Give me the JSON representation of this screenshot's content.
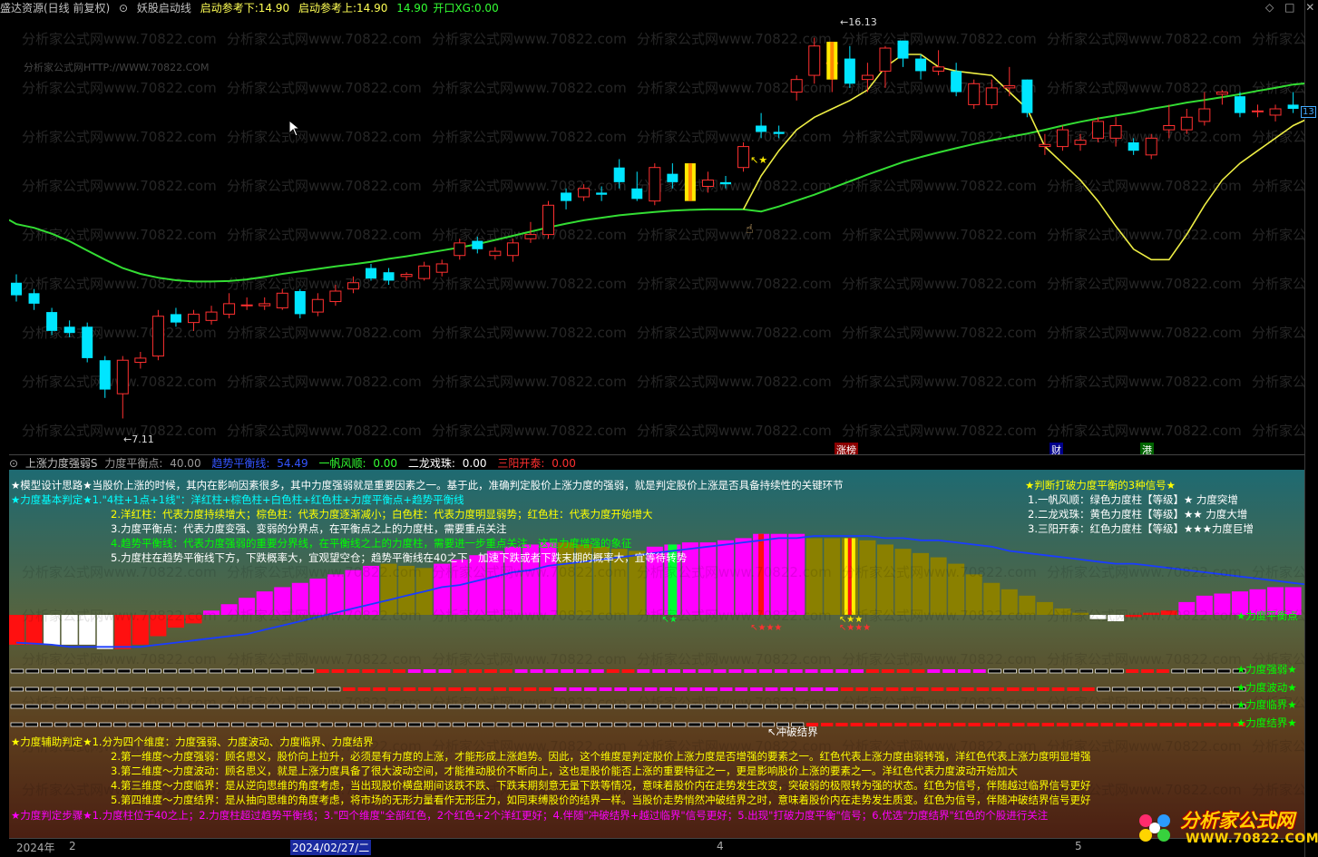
{
  "title_bar": {
    "app": "盛达资源(日线 前复权)",
    "indicator": "妖股启动线",
    "lower_ref_label": "启动参考下:",
    "lower_ref_value": "14.90",
    "upper_ref_label": "启动参考上:",
    "upper_ref_value": "14.90",
    "open_label": "14.90",
    "xg_label": "开口XG:",
    "xg_value": "0.00"
  },
  "watermark": {
    "line": "分析家公式网www.70822.com",
    "url": "分析家公式网HTTP://WWW.70822.COM"
  },
  "price_labels": {
    "high": "16.13",
    "low": "7.11",
    "right_tag": "13"
  },
  "main_marks": {
    "zhangbang": "涨榜",
    "cai": "财",
    "gang": "港"
  },
  "indicator_bar": {
    "name": "上涨力度强弱S",
    "balance_label": "力度平衡点:",
    "balance_value": "40.00",
    "trend_label": "趋势平衡线:",
    "trend_value": "54.49",
    "yifan_label": "一帆风顺:",
    "yifan_value": "0.00",
    "erlong_label": "二龙戏珠:",
    "erlong_value": "0.00",
    "sanyang_label": "三阳开泰:",
    "sanyang_value": "0.00"
  },
  "notes_top": [
    "★模型设计思路★当股价上涨的时候，其内在影响因素很多，其中力度强弱就是重要因素之一。基于此，准确判定股价上涨力度的强弱，就是判定股价上涨是否具备持续性的关键环节",
    "★力度基本判定★1.\"4柱+1点+1线\"：洋红柱+棕色柱+白色柱+红色柱+力度平衡点+趋势平衡线",
    "2.洋红柱：代表力度持续增大；棕色柱：代表力度逐渐减小；白色柱：代表力度明显弱势；红色柱：代表力度开始增大",
    "3.力度平衡点：代表力度变强、变弱的分界点，在平衡点之上的力度柱，需要重点关注",
    "4.趋势平衡线：代表力度强弱的重要分界线，在平衡线之上的力度柱，需要进一步重点关注，这是力度增强的象征",
    "5.力度柱在趋势平衡线下方，下跌概率大，宜观望空仓；趋势平衡线在40之下，加速下跌或者下跌末期的概率大，宜等待转势"
  ],
  "signals": {
    "title": "★判断打破力度平衡的3种信号★",
    "items": [
      "1.一帆风顺：绿色力度柱【等级】★    力度突增",
      "2.二龙戏珠：黄色力度柱【等级】★★  力度大增",
      "3.三阳开泰：红色力度柱【等级】★★★力度巨增"
    ]
  },
  "right_labels": {
    "balance": "★力度平衡点",
    "strength": "★力度强弱★",
    "wave": "★力度波动★",
    "critical": "★力度临界★",
    "boundary": "★力度结界★"
  },
  "chong_label": "冲破结界",
  "notes_bottom": [
    "★力度辅助判定★1.分为四个维度：力度强弱、力度波动、力度临界、力度结界",
    "2.第一维度～力度强弱：顾名思义，股价向上拉升，必须是有力度的上涨，才能形成上涨趋势。因此，这个维度是判定股价上涨力度是否增强的要素之一。红色代表上涨力度由弱转强，洋红色代表上涨力度明显增强",
    "3.第二维度～力度波动：顾名思义，就是上涨力度具备了很大波动空间，才能推动股价不断向上，这也是股价能否上涨的重要特征之一，更是影响股价上涨的要素之一。洋红色代表力度波动开始加大",
    "4.第三维度～力度临界：是从逆向思维的角度考虑，当出现股价横盘期间该跌不跌、下跌末期刻意无量下跌等情况，意味着股价内在走势发生改变，突破弱的极限转为强的状态。红色为信号，伴随越过临界信号更好",
    "5.第四维度～力度结界：是从抽向思维的角度考虑，将市场的无形力量看作无形压力，如同束缚股价的结界一样。当股价走势悄然冲破结界之时，意味着股价内在走势发生质变。红色为信号，伴随冲破结界信号更好",
    "★力度判定步骤★1.力度柱位于40之上；2.力度柱超过趋势平衡线；3.\"四个维度\"全部红色，2个红色+2个洋红更好；4.伴随\"冲破结界+越过临界\"信号更好；5.出现\"打破力度平衡\"信号；6.优选\"力度结界\"红色的个股进行关注"
  ],
  "date_bar": {
    "year": "2024年",
    "m2": "2",
    "cursor_date": "2024/02/27/二",
    "m4": "4",
    "m5": "5"
  },
  "logo": {
    "text": "分析家公式网",
    "url": "WWW.70822.COM"
  },
  "colors": {
    "up": "#ff3030",
    "down": "#00e5ff",
    "ma": "#33dd33",
    "yline": "#eeee44",
    "magenta": "#ff00ff",
    "olive": "#8a8000",
    "blue_line": "#1a3cff"
  },
  "candles": [
    {
      "o": 10.35,
      "c": 10.05,
      "h": 10.55,
      "l": 9.9
    },
    {
      "o": 10.1,
      "c": 9.85,
      "h": 10.2,
      "l": 9.7
    },
    {
      "o": 9.65,
      "c": 9.2,
      "h": 9.75,
      "l": 9.1
    },
    {
      "o": 9.3,
      "c": 9.15,
      "h": 9.45,
      "l": 9.05
    },
    {
      "o": 9.3,
      "c": 8.55,
      "h": 9.4,
      "l": 8.45
    },
    {
      "o": 8.5,
      "c": 7.8,
      "h": 8.6,
      "l": 7.6
    },
    {
      "o": 7.7,
      "c": 8.5,
      "h": 8.6,
      "l": 7.11
    },
    {
      "o": 8.45,
      "c": 8.55,
      "h": 8.7,
      "l": 8.3
    },
    {
      "o": 8.6,
      "c": 9.55,
      "h": 9.7,
      "l": 8.5
    },
    {
      "o": 9.6,
      "c": 9.4,
      "h": 9.75,
      "l": 9.3
    },
    {
      "o": 9.4,
      "c": 9.6,
      "h": 9.7,
      "l": 9.2
    },
    {
      "o": 9.45,
      "c": 9.65,
      "h": 9.8,
      "l": 9.35
    },
    {
      "o": 9.6,
      "c": 9.85,
      "h": 10.1,
      "l": 9.5
    },
    {
      "o": 9.8,
      "c": 9.82,
      "h": 10.0,
      "l": 9.7
    },
    {
      "o": 9.8,
      "c": 9.85,
      "h": 10.0,
      "l": 9.7
    },
    {
      "o": 9.75,
      "c": 10.1,
      "h": 10.2,
      "l": 9.7
    },
    {
      "o": 10.15,
      "c": 9.6,
      "h": 10.2,
      "l": 9.5
    },
    {
      "o": 9.65,
      "c": 9.95,
      "h": 10.1,
      "l": 9.55
    },
    {
      "o": 9.9,
      "c": 10.15,
      "h": 10.3,
      "l": 9.8
    },
    {
      "o": 10.2,
      "c": 10.35,
      "h": 10.5,
      "l": 10.1
    },
    {
      "o": 10.7,
      "c": 10.45,
      "h": 10.8,
      "l": 10.4
    },
    {
      "o": 10.6,
      "c": 10.4,
      "h": 10.7,
      "l": 10.3
    },
    {
      "o": 10.5,
      "c": 10.55,
      "h": 10.6,
      "l": 10.4
    },
    {
      "o": 10.45,
      "c": 10.75,
      "h": 10.85,
      "l": 10.4
    },
    {
      "o": 10.6,
      "c": 10.8,
      "h": 10.9,
      "l": 10.5
    },
    {
      "o": 11.0,
      "c": 11.3,
      "h": 11.4,
      "l": 10.9
    },
    {
      "o": 11.35,
      "c": 11.15,
      "h": 11.45,
      "l": 11.05
    },
    {
      "o": 11.0,
      "c": 11.1,
      "h": 11.2,
      "l": 10.9
    },
    {
      "o": 11.0,
      "c": 11.3,
      "h": 11.4,
      "l": 10.85
    },
    {
      "o": 11.4,
      "c": 11.5,
      "h": 11.8,
      "l": 11.3
    },
    {
      "o": 11.5,
      "c": 12.2,
      "h": 12.3,
      "l": 11.4
    },
    {
      "o": 12.5,
      "c": 12.3,
      "h": 12.6,
      "l": 12.1
    },
    {
      "o": 12.4,
      "c": 12.6,
      "h": 12.7,
      "l": 12.3
    },
    {
      "o": 12.5,
      "c": 12.45,
      "h": 12.65,
      "l": 12.3
    },
    {
      "o": 13.1,
      "c": 12.75,
      "h": 13.3,
      "l": 12.6
    },
    {
      "o": 12.6,
      "c": 12.35,
      "h": 13.0,
      "l": 12.3
    },
    {
      "o": 12.3,
      "c": 13.1,
      "h": 13.2,
      "l": 12.2
    },
    {
      "o": 12.95,
      "c": 12.75,
      "h": 13.2,
      "l": 12.6
    },
    {
      "o": 12.75,
      "c": 12.65,
      "h": 12.9,
      "l": 12.55
    },
    {
      "o": 12.65,
      "c": 12.8,
      "h": 13.0,
      "l": 12.5
    },
    {
      "o": 12.75,
      "c": 12.7,
      "h": 12.9,
      "l": 12.6
    },
    {
      "o": 13.1,
      "c": 13.6,
      "h": 13.7,
      "l": 13.0
    },
    {
      "o": 14.1,
      "c": 13.95,
      "h": 14.4,
      "l": 13.8
    },
    {
      "o": 13.95,
      "c": 13.9,
      "h": 14.1,
      "l": 13.8
    },
    {
      "o": 14.9,
      "c": 15.2,
      "h": 15.3,
      "l": 14.7
    },
    {
      "o": 15.3,
      "c": 16.0,
      "h": 16.2,
      "l": 15.1
    },
    {
      "o": 15.6,
      "c": 15.6,
      "h": 16.1,
      "l": 14.9
    },
    {
      "o": 15.7,
      "c": 15.1,
      "h": 16.0,
      "l": 15.0
    },
    {
      "o": 15.2,
      "c": 15.3,
      "h": 15.6,
      "l": 14.9
    },
    {
      "o": 15.4,
      "c": 15.95,
      "h": 16.0,
      "l": 15.0
    },
    {
      "o": 16.13,
      "c": 15.7,
      "h": 16.13,
      "l": 15.5
    },
    {
      "o": 15.7,
      "c": 15.4,
      "h": 15.8,
      "l": 15.2
    },
    {
      "o": 15.4,
      "c": 15.5,
      "h": 15.9,
      "l": 15.3
    },
    {
      "o": 15.4,
      "c": 14.9,
      "h": 15.6,
      "l": 14.8
    },
    {
      "o": 14.6,
      "c": 15.1,
      "h": 15.2,
      "l": 14.5
    },
    {
      "o": 14.6,
      "c": 15.0,
      "h": 15.2,
      "l": 14.5
    },
    {
      "o": 15.0,
      "c": 15.05,
      "h": 15.5,
      "l": 14.8
    },
    {
      "o": 15.2,
      "c": 14.4,
      "h": 15.2,
      "l": 14.3
    },
    {
      "o": 13.6,
      "c": 13.65,
      "h": 13.9,
      "l": 13.4
    },
    {
      "o": 13.6,
      "c": 14.0,
      "h": 14.1,
      "l": 13.5
    },
    {
      "o": 13.65,
      "c": 13.75,
      "h": 13.9,
      "l": 13.5
    },
    {
      "o": 13.8,
      "c": 14.2,
      "h": 14.3,
      "l": 13.7
    },
    {
      "o": 13.8,
      "c": 14.1,
      "h": 14.3,
      "l": 13.6
    },
    {
      "o": 13.7,
      "c": 13.5,
      "h": 13.8,
      "l": 13.4
    },
    {
      "o": 13.4,
      "c": 13.8,
      "h": 13.9,
      "l": 13.3
    },
    {
      "o": 14.0,
      "c": 14.1,
      "h": 14.6,
      "l": 13.8
    },
    {
      "o": 14.0,
      "c": 14.3,
      "h": 14.5,
      "l": 13.9
    },
    {
      "o": 14.2,
      "c": 14.5,
      "h": 14.9,
      "l": 14.1
    },
    {
      "o": 14.85,
      "c": 14.9,
      "h": 14.95,
      "l": 14.6
    },
    {
      "o": 14.8,
      "c": 14.4,
      "h": 14.9,
      "l": 14.3
    },
    {
      "o": 14.45,
      "c": 14.45,
      "h": 14.6,
      "l": 14.3
    },
    {
      "o": 14.35,
      "c": 14.5,
      "h": 14.6,
      "l": 14.2
    },
    {
      "o": 14.6,
      "c": 14.5,
      "h": 14.9,
      "l": 14.4
    },
    {
      "o": 14.4,
      "c": 14.9,
      "h": 15.3,
      "l": 14.3
    },
    {
      "o": 14.5,
      "c": 14.8,
      "h": 15.0,
      "l": 14.4
    }
  ],
  "ma_values": [
    11.75,
    11.66,
    11.52,
    11.34,
    11.12,
    10.9,
    10.7,
    10.56,
    10.47,
    10.41,
    10.38,
    10.38,
    10.39,
    10.43,
    10.49,
    10.56,
    10.62,
    10.68,
    10.74,
    10.79,
    10.85,
    10.92,
    10.98,
    11.05,
    11.12,
    11.19,
    11.27,
    11.37,
    11.47,
    11.57,
    11.67,
    11.76,
    11.84,
    11.9,
    11.96,
    12.0,
    12.04,
    12.07,
    12.09,
    12.1,
    12.1,
    12.1,
    12.05,
    12.17,
    12.31,
    12.45,
    12.61,
    12.77,
    12.93,
    13.08,
    13.23,
    13.35,
    13.46,
    13.56,
    13.66,
    13.75,
    13.83,
    13.91,
    14.0,
    14.1,
    14.19,
    14.27,
    14.34,
    14.41,
    14.5,
    14.57,
    14.65,
    14.71,
    14.78,
    14.85,
    14.93,
    15.0,
    15.08,
    15.12,
    15.15
  ],
  "yline_values": [
    null,
    null,
    null,
    null,
    null,
    null,
    null,
    null,
    null,
    null,
    null,
    null,
    null,
    null,
    null,
    null,
    null,
    null,
    null,
    null,
    null,
    null,
    null,
    null,
    null,
    null,
    null,
    null,
    null,
    null,
    null,
    null,
    null,
    null,
    null,
    null,
    null,
    null,
    null,
    null,
    null,
    12.1,
    12.9,
    13.5,
    14.0,
    14.3,
    14.5,
    14.7,
    14.95,
    15.5,
    15.8,
    15.8,
    15.5,
    15.4,
    15.35,
    15.3,
    14.9,
    14.5,
    13.6,
    13.2,
    12.8,
    12.3,
    11.7,
    11.15,
    10.9,
    10.9,
    11.5,
    12.2,
    12.8,
    13.2,
    13.5,
    13.8,
    14.1,
    14.3,
    14.5
  ],
  "bars": [
    {
      "v": -14,
      "c": "r"
    },
    {
      "v": -14,
      "c": "r"
    },
    {
      "v": -14,
      "c": "w"
    },
    {
      "v": -14,
      "c": "w"
    },
    {
      "v": -14,
      "c": "w"
    },
    {
      "v": -16,
      "c": "w"
    },
    {
      "v": -16,
      "c": "r"
    },
    {
      "v": -14,
      "c": "r"
    },
    {
      "v": -10,
      "c": "r"
    },
    {
      "v": -6,
      "c": "r"
    },
    {
      "v": -4,
      "c": "r"
    },
    {
      "v": 2,
      "c": "m"
    },
    {
      "v": 5,
      "c": "m"
    },
    {
      "v": 8,
      "c": "m"
    },
    {
      "v": 11,
      "c": "m"
    },
    {
      "v": 13,
      "c": "m"
    },
    {
      "v": 15,
      "c": "m"
    },
    {
      "v": 17,
      "c": "m"
    },
    {
      "v": 19,
      "c": "m"
    },
    {
      "v": 21,
      "c": "m"
    },
    {
      "v": 23,
      "c": "m"
    },
    {
      "v": 24,
      "c": "o"
    },
    {
      "v": 23,
      "c": "o"
    },
    {
      "v": 22,
      "c": "o"
    },
    {
      "v": 24,
      "c": "m"
    },
    {
      "v": 26,
      "c": "m"
    },
    {
      "v": 28,
      "c": "m"
    },
    {
      "v": 30,
      "c": "m"
    },
    {
      "v": 32,
      "c": "m"
    },
    {
      "v": 33,
      "c": "m"
    },
    {
      "v": 34,
      "c": "m"
    },
    {
      "v": 34,
      "c": "o"
    },
    {
      "v": 33,
      "c": "o"
    },
    {
      "v": 32,
      "c": "o"
    },
    {
      "v": 31,
      "c": "o"
    },
    {
      "v": 30,
      "c": "o"
    },
    {
      "v": 32,
      "c": "m"
    },
    {
      "v": 33,
      "c": "g"
    },
    {
      "v": 34,
      "c": "m"
    },
    {
      "v": 34,
      "c": "m"
    },
    {
      "v": 35,
      "c": "m"
    },
    {
      "v": 36,
      "c": "m"
    },
    {
      "v": 38,
      "c": "rm"
    },
    {
      "v": 38,
      "c": "m"
    },
    {
      "v": 38,
      "c": "m"
    },
    {
      "v": 36,
      "c": "o"
    },
    {
      "v": 36,
      "c": "o"
    },
    {
      "v": 36,
      "c": "yr"
    },
    {
      "v": 35,
      "c": "o"
    },
    {
      "v": 33,
      "c": "o"
    },
    {
      "v": 31,
      "c": "o"
    },
    {
      "v": 29,
      "c": "o"
    },
    {
      "v": 27,
      "c": "o"
    },
    {
      "v": 24,
      "c": "o"
    },
    {
      "v": 19,
      "c": "o"
    },
    {
      "v": 15,
      "c": "o"
    },
    {
      "v": 12,
      "c": "o"
    },
    {
      "v": 9,
      "c": "o"
    },
    {
      "v": 6,
      "c": "o"
    },
    {
      "v": 3,
      "c": "o"
    },
    {
      "v": 1,
      "c": "o"
    },
    {
      "v": -2,
      "c": "w"
    },
    {
      "v": -3,
      "c": "w"
    },
    {
      "v": -1,
      "c": "r"
    },
    {
      "v": 1,
      "c": "r"
    },
    {
      "v": 2,
      "c": "r"
    },
    {
      "v": 6,
      "c": "m"
    },
    {
      "v": 9,
      "c": "m"
    },
    {
      "v": 10,
      "c": "m"
    },
    {
      "v": 11,
      "c": "m"
    },
    {
      "v": 12,
      "c": "m"
    },
    {
      "v": 13,
      "c": "m"
    },
    {
      "v": 13,
      "c": "m"
    }
  ],
  "trend_values": [
    -13,
    -13.5,
    -14,
    -15,
    -15,
    -15,
    -15,
    -15,
    -14,
    -13,
    -12,
    -11,
    -10,
    -9,
    -7,
    -5,
    -3,
    -1,
    1,
    3,
    5,
    7,
    9,
    11,
    13,
    14,
    16,
    18,
    20,
    21,
    23,
    24,
    25,
    26,
    27,
    28,
    29,
    30,
    31,
    32,
    33,
    34,
    35,
    36,
    36,
    37,
    37,
    37,
    37,
    36,
    36,
    35,
    35,
    34,
    33,
    32,
    30,
    29,
    28,
    27,
    26,
    25,
    24,
    24,
    23,
    22,
    21,
    20,
    19,
    18,
    17,
    16,
    15,
    14,
    13
  ],
  "row_strength": "wwwwwwwwwwwwwwwwwwwwrrrrrrmmmrrrrmmmmmmrrmmmmmmmmmmmmmmmrrrrmmmmwwwwwwwwwrrrwwwww",
  "row_wave": "wwwwwwwwwwwwwwwwwwwwwwrrrrrrrrrrrrrrmmmmmmmmmmmmmmmmmmmrrrrrrrrrrrrrrrrrwwwwwwwwww",
  "row_critical": "wwwwwwwwwwwwwwwwwwwwwwwwwwwwwwwwwwwwwwwwwwwwwwwwwwwwwwwwwwwwwwwwwwwwwwwwwwwwwwwwww",
  "row_boundary": "wwwwwwwwwwwwwwwwwwwwwwwwwwwwwwwwwwwwwwwwwwwwwwwwwwwwwwrrrrrrrrrrrrrrrrrrrrrrrrrrrrrr"
}
